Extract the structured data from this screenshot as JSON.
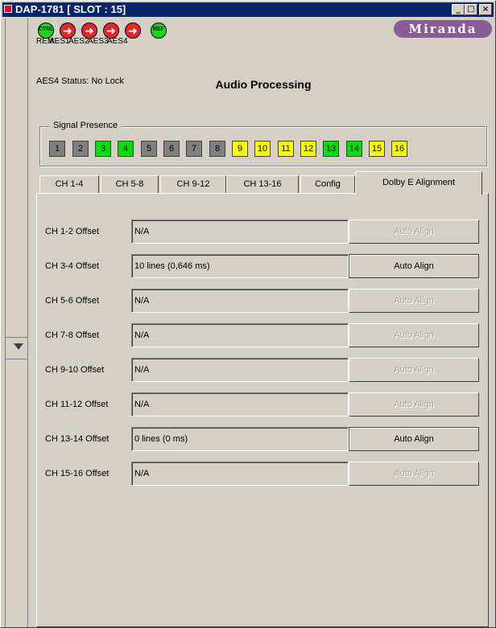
{
  "window": {
    "title": "DAP-1781 [ SLOT : 15]",
    "minimize": "_",
    "maximize": "□",
    "close": "×"
  },
  "status": {
    "icons": [
      {
        "name": "ctrl-icon",
        "label": "REM",
        "text": "CTRL",
        "color": "#1fd21f"
      },
      {
        "name": "aes1-icon",
        "label": "AES1",
        "text": "",
        "color": "#e6262b"
      },
      {
        "name": "aes2-icon",
        "label": "AES2",
        "text": "",
        "color": "#e6262b"
      },
      {
        "name": "aes3-icon",
        "label": "AES3",
        "text": "",
        "color": "#e6262b"
      },
      {
        "name": "aes4-icon",
        "label": "AES4",
        "text": "",
        "color": "#e6262b"
      },
      {
        "name": "ref-icon",
        "label": "",
        "text": "REF",
        "color": "#1fd21f"
      }
    ],
    "aes4_status": "AES4 Status: No Lock"
  },
  "logo": "Miranda",
  "page_title": "Audio Processing",
  "signal_presence": {
    "legend": "Signal Presence",
    "channels": [
      {
        "label": "1",
        "color": "#808080"
      },
      {
        "label": "2",
        "color": "#808080"
      },
      {
        "label": "3",
        "color": "#00e000"
      },
      {
        "label": "4",
        "color": "#00e000"
      },
      {
        "label": "5",
        "color": "#808080"
      },
      {
        "label": "6",
        "color": "#808080"
      },
      {
        "label": "7",
        "color": "#808080"
      },
      {
        "label": "8",
        "color": "#808080"
      },
      {
        "label": "9",
        "color": "#ffff00"
      },
      {
        "label": "10",
        "color": "#ffff00"
      },
      {
        "label": "11",
        "color": "#ffff00"
      },
      {
        "label": "12",
        "color": "#ffff00"
      },
      {
        "label": "13",
        "color": "#00e000"
      },
      {
        "label": "14",
        "color": "#00e000"
      },
      {
        "label": "15",
        "color": "#ffff00"
      },
      {
        "label": "16",
        "color": "#ffff00"
      }
    ]
  },
  "tabs": [
    {
      "label": "CH 1-4",
      "active": false
    },
    {
      "label": "CH 5-8",
      "active": false
    },
    {
      "label": "CH 9-12",
      "active": false
    },
    {
      "label": "CH 13-16",
      "active": false
    },
    {
      "label": "Config",
      "active": false
    },
    {
      "label": "Dolby E Alignment",
      "active": true
    }
  ],
  "offsets": [
    {
      "label": "CH 1-2 Offset",
      "value": "N/A",
      "button": "Auto Align",
      "enabled": false
    },
    {
      "label": "CH 3-4 Offset",
      "value": "10 lines (0,646 ms)",
      "button": "Auto Align",
      "enabled": true
    },
    {
      "label": "CH 5-6 Offset",
      "value": "N/A",
      "button": "Auto Align",
      "enabled": false
    },
    {
      "label": "CH 7-8 Offset",
      "value": "N/A",
      "button": "Auto Align",
      "enabled": false
    },
    {
      "label": "CH 9-10 Offset",
      "value": "N/A",
      "button": "Auto Align",
      "enabled": false
    },
    {
      "label": "CH 11-12 Offset",
      "value": "N/A",
      "button": "Auto Align",
      "enabled": false
    },
    {
      "label": "CH 13-14 Offset",
      "value": "0 lines (0 ms)",
      "button": "Auto Align",
      "enabled": true
    },
    {
      "label": "CH 15-16 Offset",
      "value": "N/A",
      "button": "Auto Align",
      "enabled": false
    }
  ]
}
